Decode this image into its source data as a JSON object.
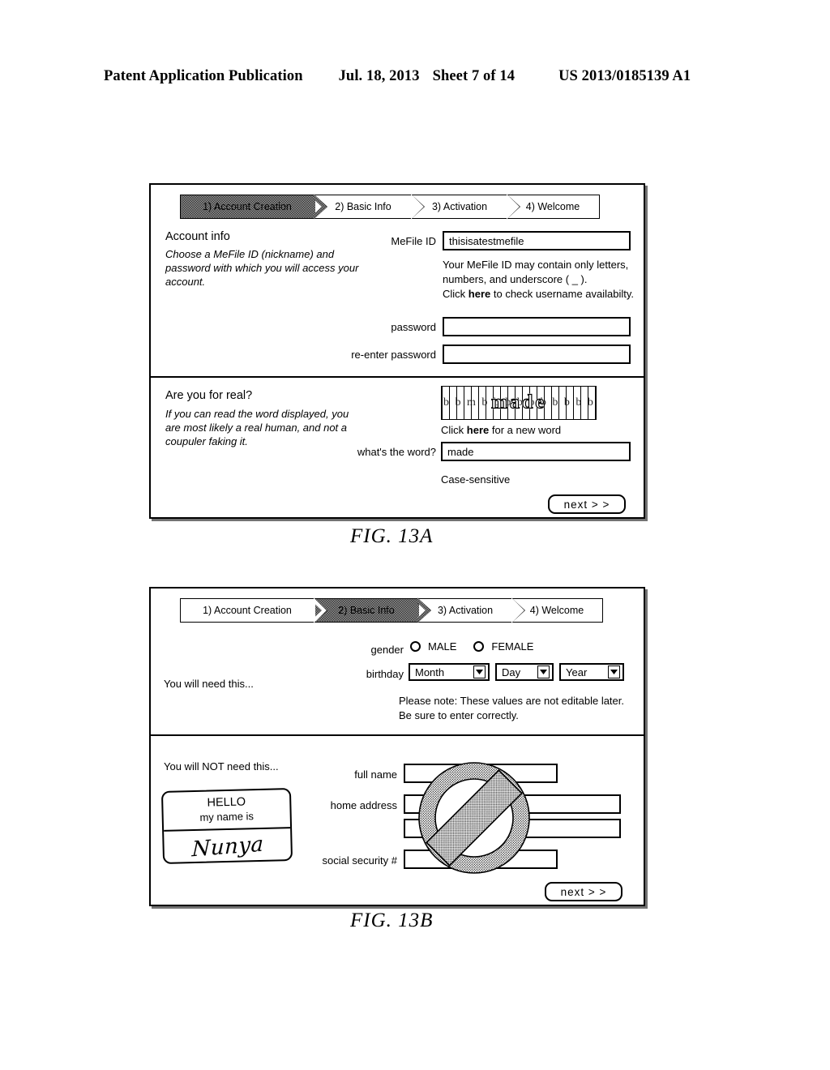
{
  "header": {
    "publication": "Patent Application Publication",
    "date": "Jul. 18, 2013",
    "sheet": "Sheet 7 of 14",
    "number": "US 2013/0185139 A1"
  },
  "figures": [
    {
      "id": "13A",
      "caption": "FIG. 13A",
      "steps": [
        {
          "label": "1) Account Creation",
          "active": true
        },
        {
          "label": "2) Basic Info",
          "active": false
        },
        {
          "label": "3) Activation",
          "active": false
        },
        {
          "label": "4) Welcome",
          "active": false
        }
      ],
      "section_account": {
        "heading": "Account info",
        "description": "Choose a MeFile ID (nickname) and password with which you will access your account.",
        "mefile_label": "MeFile ID",
        "mefile_value": "thisisatestmefile",
        "hint_line1": "Your MeFile ID may contain only letters,",
        "hint_line2": "numbers, and underscore ( _ ).",
        "hint_line3_pre": "Click ",
        "hint_line3_link": "here",
        "hint_line3_post": " to check username availabilty.",
        "password_label": "password",
        "password_value": "",
        "reenter_label": "re-enter password",
        "reenter_value": ""
      },
      "section_captcha": {
        "heading": "Are you for real?",
        "description": "If you can read the word displayed, you are most likely a real human, and not a coupuler faking it.",
        "captcha_word": "made",
        "new_word_pre": "Click ",
        "new_word_link": "here",
        "new_word_post": " for a new word",
        "answer_label": "what's the word?",
        "answer_value": "made",
        "case_note": "Case-sensitive"
      },
      "next_label": "next > >"
    },
    {
      "id": "13B",
      "caption": "FIG. 13B",
      "steps": [
        {
          "label": "1) Account Creation",
          "active": false
        },
        {
          "label": "2) Basic Info",
          "active": true
        },
        {
          "label": "3) Activation",
          "active": false
        },
        {
          "label": "4) Welcome",
          "active": false
        }
      ],
      "section_need": {
        "side_label": "You will need this...",
        "gender_label": "gender",
        "gender_options": [
          "MALE",
          "FEMALE"
        ],
        "birthday_label": "birthday",
        "birthday_selects": [
          "Month",
          "Day",
          "Year"
        ],
        "note_line1": "Please note: These values are not editable later.",
        "note_line2": "Be sure to enter correctly."
      },
      "section_not_need": {
        "side_label": "You will NOT need this...",
        "nametag": {
          "hello": "HELLO",
          "my_name_is": "my name is",
          "signature": "Nunya"
        },
        "fields": [
          {
            "label": "full name",
            "value": ""
          },
          {
            "label": "home address",
            "value": ""
          },
          {
            "label": "",
            "value": ""
          },
          {
            "label": "social security #",
            "value": ""
          }
        ],
        "overlay_icon": "prohibition-icon"
      },
      "next_label": "next > >"
    }
  ]
}
